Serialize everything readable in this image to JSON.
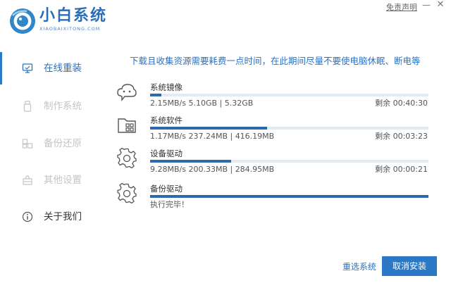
{
  "app": {
    "title": "小白系统",
    "subtitle": "XIAOBAIXITONG.COM",
    "disclaimer": "免责声明",
    "minimize": "—",
    "close": "✕"
  },
  "sidebar": {
    "items": [
      {
        "label": "在线重装",
        "icon": "monitor-icon",
        "active": true
      },
      {
        "label": "制作系统",
        "icon": "usb-drive-icon"
      },
      {
        "label": "备份还原",
        "icon": "backup-icon"
      },
      {
        "label": "其他设置",
        "icon": "settings-box-icon"
      },
      {
        "label": "关于我们",
        "icon": "info-icon"
      }
    ]
  },
  "notice": "下载且收集资源需要耗费一点时间，在此期间尽量不要使电脑休眠、断电等",
  "tasks": [
    {
      "name": "系统镜像",
      "icon": "cloud-chat-icon",
      "progress": 0.04,
      "stats": "2.15MB/s 5.10GB | 5.32GB",
      "remaining": "剩余 00:40:30"
    },
    {
      "name": "系统软件",
      "icon": "software-folder-icon",
      "progress": 0.42,
      "stats": "1.17MB/s 237.24MB | 416.19MB",
      "remaining": "剩余 00:03:23"
    },
    {
      "name": "设备驱动",
      "icon": "gear-icon",
      "progress": 0.29,
      "stats": "9.28MB/s 200.33MB | 284.95MB",
      "remaining": "剩余 00:00:21"
    },
    {
      "name": "备份驱动",
      "icon": "gear-icon",
      "progress": 1.0,
      "stats": "执行完毕！",
      "remaining": ""
    }
  ],
  "footer": {
    "reselect": "重选系统",
    "cancel": "取消安装"
  },
  "colors": {
    "accent": "#2a78c6",
    "progress": "#2c6aad",
    "track": "#e4eaf1",
    "inactive": "#c4c4c4"
  }
}
